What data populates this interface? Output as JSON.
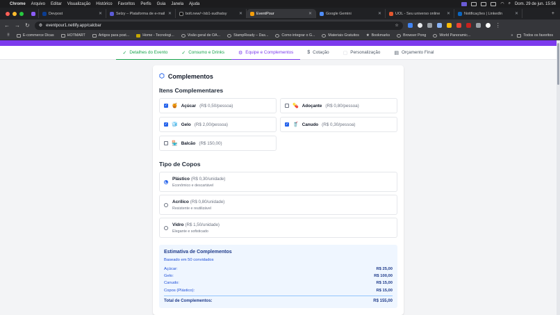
{
  "menubar": {
    "items": [
      "Chrome",
      "Arquivo",
      "Editar",
      "Visualização",
      "Histórico",
      "Favoritos",
      "Perfis",
      "Guia",
      "Janela",
      "Ajuda"
    ],
    "clock": "Dom. 29 de jun.  15:56"
  },
  "tabs": [
    {
      "title": "Devpost",
      "color": "#0b3d91",
      "active": false
    },
    {
      "title": "Selzy – Plataforma de e-mail",
      "color": "#5b5bd6",
      "active": false
    },
    {
      "title": "bolt.new/~/sb1-sudhatsy",
      "color": "#111111",
      "active": false
    },
    {
      "title": "EventPour",
      "color": "#f59e0b",
      "active": true
    },
    {
      "title": "Google Gemini",
      "color": "#4f8df7",
      "active": false
    },
    {
      "title": "UOL - Seu universo online",
      "color": "#e4572e",
      "active": false
    },
    {
      "title": "Notificações | LinkedIn",
      "color": "#0a66c2",
      "active": false
    }
  ],
  "omnibox": {
    "url": "eventpour1.netlify.app/calcbar"
  },
  "bookmarks": {
    "items": [
      "E-commerce Dicas",
      "HOTMART",
      "Artigos para post...",
      "Home - Tecnologi...",
      "Visão geral de OA...",
      "StampReady – Das...",
      "Como integrar o G...",
      "Materiais Gratuitos",
      "Bookmarks",
      "Browser Pong",
      "World Panoramic..."
    ],
    "all": "Todos os favoritos"
  },
  "steps": [
    {
      "label": "Detalhes do Evento",
      "state": "done",
      "icon": "✓"
    },
    {
      "label": "Consumo e Drinks",
      "state": "done",
      "icon": "✓"
    },
    {
      "label": "Equipe e Complementos",
      "state": "active",
      "icon": "⚙"
    },
    {
      "label": "Cotação",
      "state": "todo",
      "icon": "$"
    },
    {
      "label": "Personalização",
      "state": "todo",
      "icon": "▢"
    },
    {
      "label": "Orçamento Final",
      "state": "todo",
      "icon": "▤"
    }
  ],
  "card": {
    "title": "Complementos",
    "items_heading": "Itens Complementares",
    "items": [
      {
        "name": "Açúcar",
        "price": "(R$ 0,50/pessoa)",
        "checked": true,
        "emoji": "🍯"
      },
      {
        "name": "Adoçante",
        "price": "(R$ 0,80/pessoa)",
        "checked": false,
        "emoji": "💊"
      },
      {
        "name": "Gelo",
        "price": "(R$ 2,00/pessoa)",
        "checked": true,
        "emoji": "🧊"
      },
      {
        "name": "Canudo",
        "price": "(R$ 0,30/pessoa)",
        "checked": true,
        "emoji": "🥤"
      },
      {
        "name": "Balcão",
        "price": "(R$ 150,00)",
        "checked": false,
        "emoji": "🏪"
      }
    ],
    "cups_heading": "Tipo de Copos",
    "cups": [
      {
        "name": "Plástico",
        "price": "(R$ 0,30/unidade)",
        "desc": "Econômico e descartável",
        "selected": true
      },
      {
        "name": "Acrílico",
        "price": "(R$ 0,80/unidade)",
        "desc": "Resistente e reutilizável",
        "selected": false
      },
      {
        "name": "Vidro",
        "price": "(R$ 1,50/unidade)",
        "desc": "Elegante e sofisticado",
        "selected": false
      }
    ],
    "estimate": {
      "title": "Estimativa de Complementos",
      "subtitle": "Baseado em 50 convidados",
      "lines": [
        {
          "label": "Açúcar:",
          "value": "R$ 25,00"
        },
        {
          "label": "Gelo:",
          "value": "R$ 100,00"
        },
        {
          "label": "Canudo:",
          "value": "R$ 15,00"
        },
        {
          "label": "Copos (Plástico):",
          "value": "R$ 15,00"
        }
      ],
      "total_label": "Total de Complementos:",
      "total_value": "R$ 155,00"
    }
  }
}
